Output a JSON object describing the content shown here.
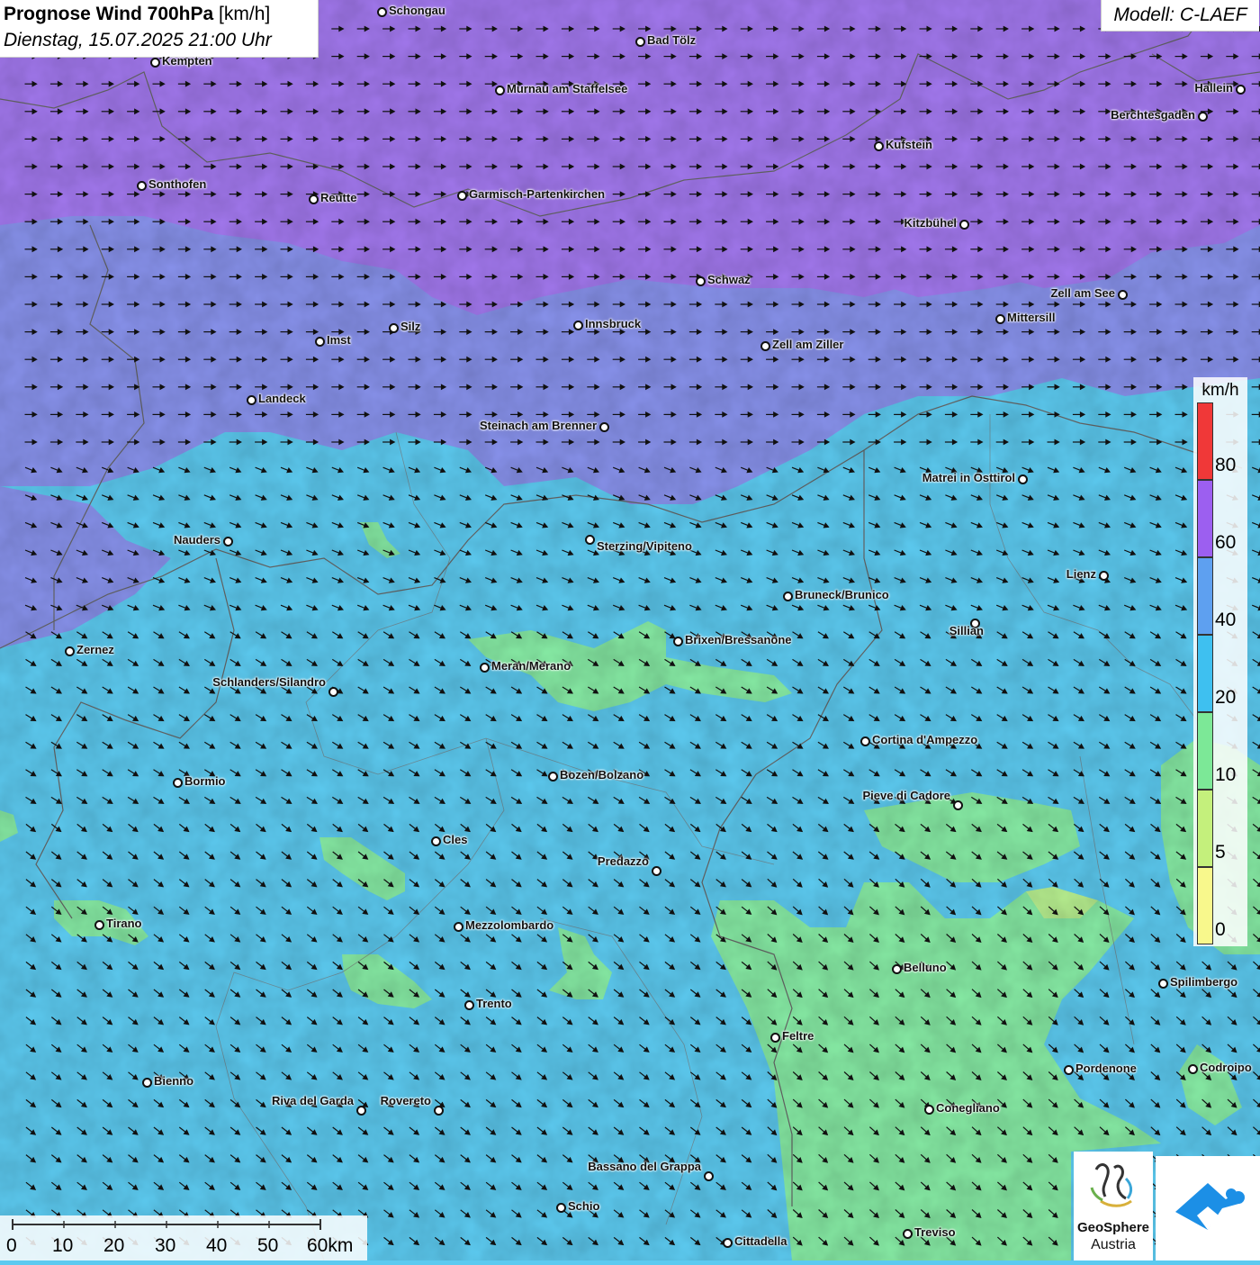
{
  "title": {
    "main": "Prognose Wind 700hPa",
    "unit": "[km/h]",
    "datetime": "Dienstag, 15.07.2025 21:00 Uhr"
  },
  "model": "Modell: C-LAEF",
  "legend": {
    "unit": "km/h",
    "ticks": [
      "80",
      "60",
      "40",
      "20",
      "10",
      "5",
      "0"
    ],
    "colors": [
      "#f03838",
      "#9c5ff0",
      "#5ea0f0",
      "#3ec0f0",
      "#7ce897",
      "#c4f07c",
      "#f8f88c"
    ]
  },
  "scale": {
    "labels": [
      "0",
      "10",
      "20",
      "30",
      "40",
      "50",
      "60km"
    ]
  },
  "logos": {
    "geosphere_line1": "GeoSphere",
    "geosphere_line2": "Austria"
  },
  "colors": {
    "wind_60_80": "#a278ee",
    "wind_40_60": "#8892ec",
    "wind_20_40": "#5ccaf0",
    "wind_10_20": "#86eaa4",
    "wind_5_10": "#b8f090",
    "arrow": "#111111"
  },
  "cities": [
    {
      "name": "Schongau"
    },
    {
      "name": "Bad Tölz"
    },
    {
      "name": "Kempten"
    },
    {
      "name": "Murnau am Staffelsee"
    },
    {
      "name": "Hallein"
    },
    {
      "name": "Berchtesgaden"
    },
    {
      "name": "Kufstein"
    },
    {
      "name": "Sonthofen"
    },
    {
      "name": "Reutte"
    },
    {
      "name": "Garmisch-Partenkirchen"
    },
    {
      "name": "Kitzbühel"
    },
    {
      "name": "Schwaz"
    },
    {
      "name": "Zell am See"
    },
    {
      "name": "Mittersill"
    },
    {
      "name": "Silz"
    },
    {
      "name": "Innsbruck"
    },
    {
      "name": "Imst"
    },
    {
      "name": "Zell am Ziller"
    },
    {
      "name": "Landeck"
    },
    {
      "name": "Steinach am Brenner"
    },
    {
      "name": "Matrei in Osttirol"
    },
    {
      "name": "Nauders"
    },
    {
      "name": "Sterzing/Vipiteno"
    },
    {
      "name": "Lienz"
    },
    {
      "name": "Bruneck/Brunico"
    },
    {
      "name": "Sillian"
    },
    {
      "name": "Zernez"
    },
    {
      "name": "Brixen/Bressanone"
    },
    {
      "name": "Meran/Merano"
    },
    {
      "name": "Schlanders/Silandro"
    },
    {
      "name": "Cortina d'Ampezzo"
    },
    {
      "name": "Bozen/Bolzano"
    },
    {
      "name": "Bormio"
    },
    {
      "name": "Pieve di Cadore"
    },
    {
      "name": "Cles"
    },
    {
      "name": "Predazzo"
    },
    {
      "name": "Tirano"
    },
    {
      "name": "Mezzolombardo"
    },
    {
      "name": "Belluno"
    },
    {
      "name": "Spilimbergo"
    },
    {
      "name": "Trento"
    },
    {
      "name": "Feltre"
    },
    {
      "name": "Pordenone"
    },
    {
      "name": "Codroipo"
    },
    {
      "name": "Bienno"
    },
    {
      "name": "Riva del Garda"
    },
    {
      "name": "Rovereto"
    },
    {
      "name": "Conegliano"
    },
    {
      "name": "Bassano del Grappa"
    },
    {
      "name": "Schio"
    },
    {
      "name": "Treviso"
    },
    {
      "name": "Cittadella"
    }
  ]
}
